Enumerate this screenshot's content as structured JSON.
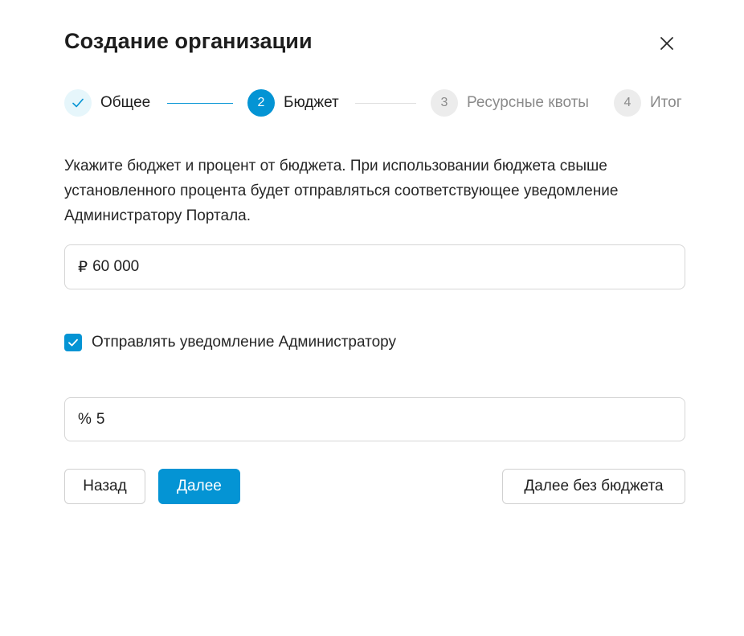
{
  "dialog": {
    "title": "Создание организации",
    "close_icon": "close-icon"
  },
  "stepper": {
    "steps": [
      {
        "index": "1",
        "label": "Общее",
        "state": "done",
        "icon": "check-icon"
      },
      {
        "index": "2",
        "label": "Бюджет",
        "state": "active"
      },
      {
        "index": "3",
        "label": "Ресурсные квоты",
        "state": "pending"
      },
      {
        "index": "4",
        "label": "Итог",
        "state": "pending"
      }
    ]
  },
  "description": "Укажите бюджет и процент от бюджета. При использовании бюджета свыше установленного процента будет отправляться соответствующее уведомление Администратору Портала.",
  "budget_field": {
    "prefix": "₽",
    "value": "60 000"
  },
  "notify_checkbox": {
    "checked": true,
    "label": "Отправлять уведомление Администратору",
    "icon": "check-icon"
  },
  "percent_field": {
    "prefix": "%",
    "value": "5"
  },
  "buttons": {
    "back": "Назад",
    "next": "Далее",
    "next_without_budget": "Далее без бюджета"
  },
  "colors": {
    "accent": "#0494d4",
    "done_step_bg": "#e6f6fb",
    "pending_step_bg": "#ececec",
    "pending_text": "#8a8a8a"
  }
}
